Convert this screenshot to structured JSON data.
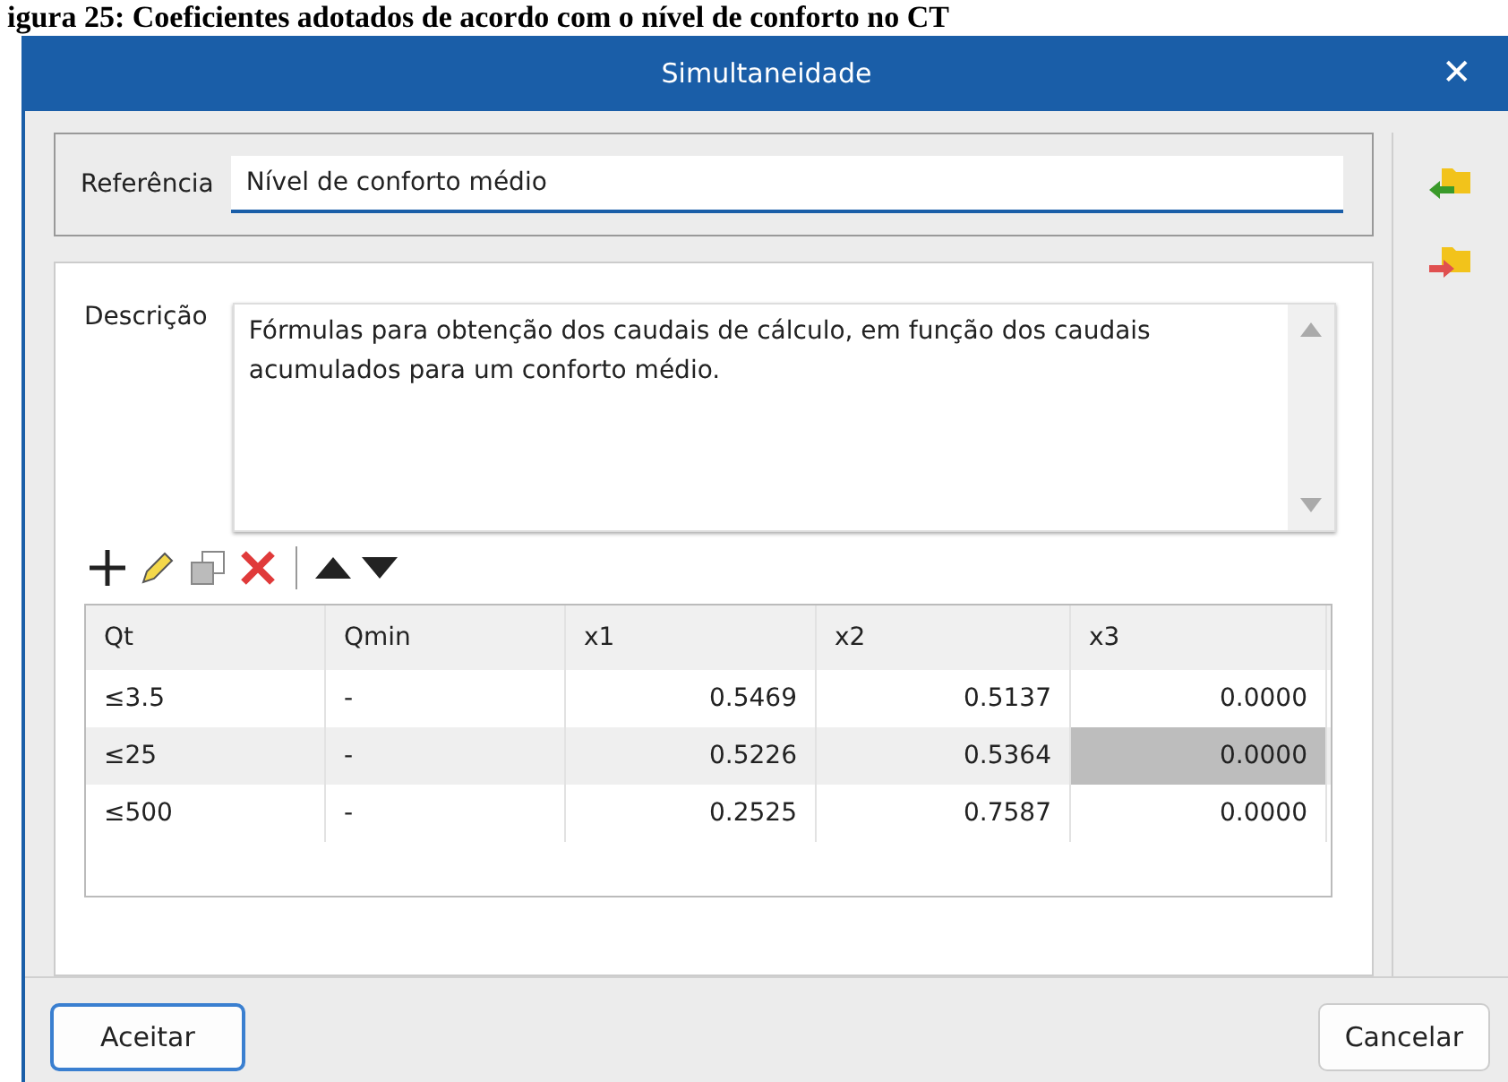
{
  "caption": "igura 25: Coeficientes adotados de acordo com o nível de conforto no CT",
  "window": {
    "title": "Simultaneidade",
    "close": "✕"
  },
  "reference": {
    "label": "Referência",
    "value": "Nível de conforto médio"
  },
  "description": {
    "label": "Descrição",
    "value": "Fórmulas para obtenção dos caudais de cálculo, em função dos caudais acumulados para um conforto médio."
  },
  "table": {
    "columns": [
      {
        "label": "Qt",
        "kind": "text"
      },
      {
        "label": "Qmin",
        "kind": "text"
      },
      {
        "label": "x1",
        "kind": "number"
      },
      {
        "label": "x2",
        "kind": "number"
      },
      {
        "label": "x3",
        "kind": "number"
      }
    ],
    "rows": [
      {
        "selected": false,
        "cells": [
          {
            "text": "≤3.5",
            "selected": false
          },
          {
            "text": "-",
            "selected": false
          },
          {
            "text": "0.5469",
            "selected": false
          },
          {
            "text": "0.5137",
            "selected": false
          },
          {
            "text": "0.0000",
            "selected": false
          }
        ]
      },
      {
        "selected": true,
        "cells": [
          {
            "text": "≤25",
            "selected": false
          },
          {
            "text": "-",
            "selected": false
          },
          {
            "text": "0.5226",
            "selected": false
          },
          {
            "text": "0.5364",
            "selected": false
          },
          {
            "text": "0.0000",
            "selected": true
          }
        ]
      },
      {
        "selected": false,
        "cells": [
          {
            "text": "≤500",
            "selected": false
          },
          {
            "text": "-",
            "selected": false
          },
          {
            "text": "0.2525",
            "selected": false
          },
          {
            "text": "0.7587",
            "selected": false
          },
          {
            "text": "0.0000",
            "selected": false
          }
        ]
      }
    ]
  },
  "buttons": [
    {
      "label": "Aceitar",
      "default": true
    },
    {
      "label": "Cancelar",
      "default": false
    }
  ]
}
